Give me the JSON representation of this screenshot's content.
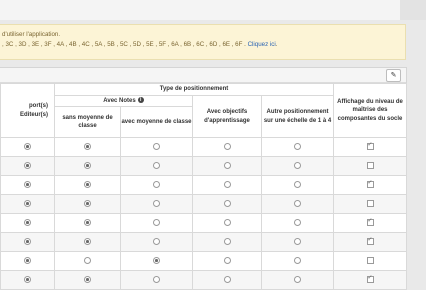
{
  "alert": {
    "line1": "d'utiliser l'application.",
    "line2_classes": ", 3C , 3D , 3E , 3F , 4A , 4B , 4C , 5A , 5B , 5C , 5D , 5E , 5F , 6A , 6B , 6C , 6D , 6E , 6F .",
    "line2_link": "Cliquez ici",
    "line2_end": "."
  },
  "panel": {
    "edit_icon": "pencil-icon"
  },
  "table": {
    "col_support": "port(s) Editeur(s)",
    "type_header": "Type de positionnement",
    "notes_header": "Avec Notes",
    "info_icon": "info-icon",
    "sub_headers": [
      "sans moyenne de classe",
      "avec moyenne de classe",
      "Avec objectifs d'apprentissage",
      "Autre positionnement sur une échelle de 1 à 4"
    ],
    "display_header": "Affichage du niveau de maîtrise des composantes du socle",
    "rows": [
      {
        "support": true,
        "selected": 0,
        "display": true
      },
      {
        "support": true,
        "selected": 0,
        "display": false
      },
      {
        "support": true,
        "selected": 0,
        "display": true
      },
      {
        "support": true,
        "selected": 0,
        "display": false
      },
      {
        "support": true,
        "selected": 0,
        "display": true
      },
      {
        "support": true,
        "selected": 0,
        "display": true
      },
      {
        "support": true,
        "selected": 1,
        "display": false
      },
      {
        "support": true,
        "selected": 0,
        "display": true
      }
    ]
  }
}
